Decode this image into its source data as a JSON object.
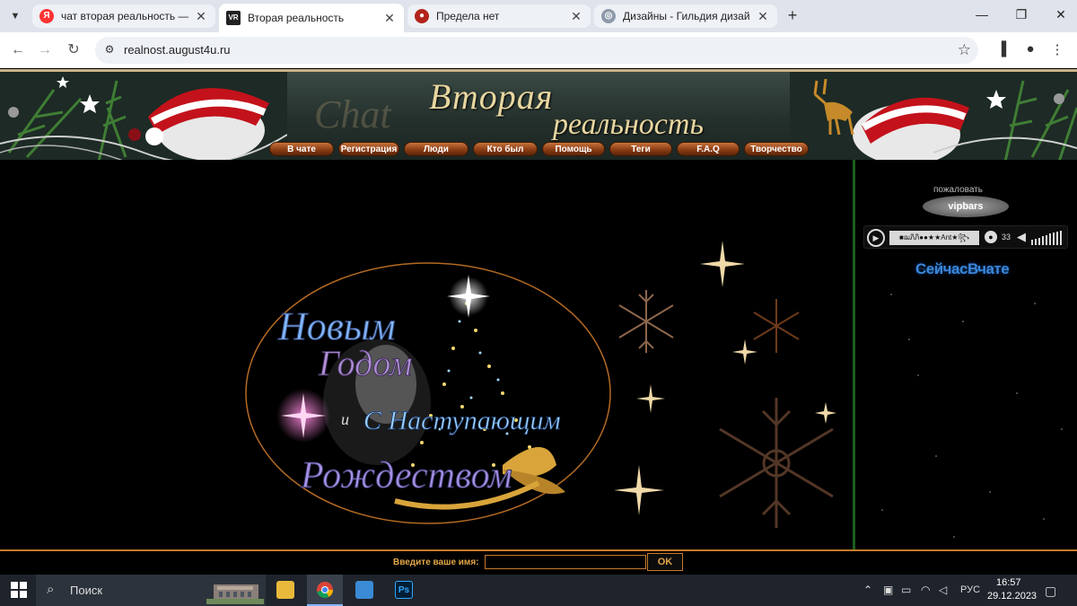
{
  "browser": {
    "tabs": [
      {
        "title": "чат вторая реальность — Яндекс",
        "favicon": "yandex-icon",
        "active": false
      },
      {
        "title": "Вторая реальность",
        "favicon": "vr-icon",
        "active": true
      },
      {
        "title": "Предела нет",
        "favicon": "apple-icon",
        "active": false
      },
      {
        "title": "Дизайны - Гильдия дизайнеров",
        "favicon": "globe-icon",
        "active": false
      }
    ],
    "url": "realnost.august4u.ru"
  },
  "site": {
    "chat_word": "Chat",
    "title_line1": "Вторая",
    "title_line2": "реальность",
    "nav": [
      "В чате",
      "Регистрация",
      "Люди",
      "Кто был",
      "Помощь",
      "Теги",
      "F.A.Q",
      "Творчество"
    ],
    "greeting": {
      "line1": "Новым",
      "line2": "Годом",
      "conj": "и",
      "line3": "С Наступающим",
      "line4": "Рождеством"
    }
  },
  "sidebar": {
    "vip_welcome": "пожаловать",
    "vip_logo": "vipbars",
    "player": {
      "track": "■ฌภิภิ●●★★Ant★꧂",
      "listeners": "33"
    },
    "now_in_chat": "СейчасВчате"
  },
  "login": {
    "label": "Введите ваше имя:",
    "value": "",
    "ok_label": "OK"
  },
  "taskbar": {
    "search_placeholder": "Поиск",
    "language": "РУС",
    "time": "16:57",
    "date": "29.12.2023"
  },
  "colors": {
    "accent_orange": "#c67a2a",
    "label_gold": "#e2a64a",
    "sidebar_border": "#1c5c1c",
    "nowchat_blue": "#3b86d6"
  }
}
